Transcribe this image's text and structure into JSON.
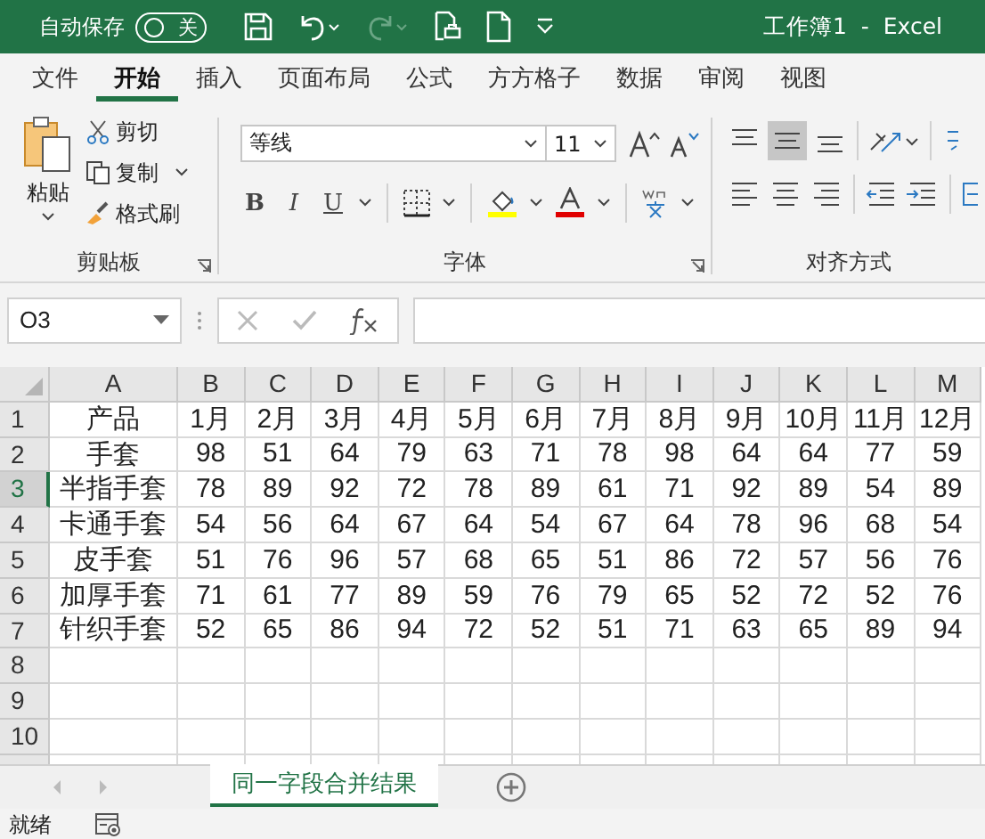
{
  "title_bar": {
    "autosave_label": "自动保存",
    "autosave": {
      "on": false,
      "label": "关"
    },
    "title": "工作簿1  -  Excel"
  },
  "tabs": [
    {
      "label": "文件",
      "selected": false
    },
    {
      "label": "开始",
      "selected": true
    },
    {
      "label": "插入",
      "selected": false
    },
    {
      "label": "页面布局",
      "selected": false
    },
    {
      "label": "公式",
      "selected": false
    },
    {
      "label": "方方格子",
      "selected": false
    },
    {
      "label": "数据",
      "selected": false
    },
    {
      "label": "审阅",
      "selected": false
    },
    {
      "label": "视图",
      "selected": false
    }
  ],
  "clipboard": {
    "paste": "粘贴",
    "cut": "剪切",
    "copy": "复制",
    "format_painter": "格式刷",
    "label": "剪贴板"
  },
  "font": {
    "name": "等线",
    "size": "11",
    "label": "字体",
    "bold": "B",
    "italic": "I",
    "underline": "U"
  },
  "alignment": {
    "label": "对齐方式"
  },
  "formula_bar": {
    "name_box": "O3"
  },
  "sheet": {
    "columns": [
      "A",
      "B",
      "C",
      "D",
      "E",
      "F",
      "G",
      "H",
      "I",
      "J",
      "K",
      "L",
      "M"
    ],
    "rows": [
      {
        "number": "1",
        "selected": false,
        "cells": [
          "产品",
          "1月",
          "2月",
          "3月",
          "4月",
          "5月",
          "6月",
          "7月",
          "8月",
          "9月",
          "10月",
          "11月",
          "12月"
        ]
      },
      {
        "number": "2",
        "selected": false,
        "cells": [
          "手套",
          "98",
          "51",
          "64",
          "79",
          "63",
          "71",
          "78",
          "98",
          "64",
          "64",
          "77",
          "59"
        ]
      },
      {
        "number": "3",
        "selected": true,
        "cells": [
          "半指手套",
          "78",
          "89",
          "92",
          "72",
          "78",
          "89",
          "61",
          "71",
          "92",
          "89",
          "54",
          "89"
        ]
      },
      {
        "number": "4",
        "selected": false,
        "cells": [
          "卡通手套",
          "54",
          "56",
          "64",
          "67",
          "64",
          "54",
          "67",
          "64",
          "78",
          "96",
          "68",
          "54"
        ]
      },
      {
        "number": "5",
        "selected": false,
        "cells": [
          "皮手套",
          "51",
          "76",
          "96",
          "57",
          "68",
          "65",
          "51",
          "86",
          "72",
          "57",
          "56",
          "76"
        ]
      },
      {
        "number": "6",
        "selected": false,
        "cells": [
          "加厚手套",
          "71",
          "61",
          "77",
          "89",
          "59",
          "76",
          "79",
          "65",
          "52",
          "72",
          "52",
          "76"
        ]
      },
      {
        "number": "7",
        "selected": false,
        "cells": [
          "针织手套",
          "52",
          "65",
          "86",
          "94",
          "72",
          "52",
          "51",
          "71",
          "63",
          "65",
          "89",
          "94"
        ]
      },
      {
        "number": "8",
        "selected": false,
        "cells": []
      },
      {
        "number": "9",
        "selected": false,
        "cells": []
      },
      {
        "number": "10",
        "selected": false,
        "cells": []
      }
    ]
  },
  "sheet_tabs": [
    {
      "label": "同一字段合并结果",
      "selected": true
    }
  ],
  "status_bar": {
    "text": "就绪"
  }
}
